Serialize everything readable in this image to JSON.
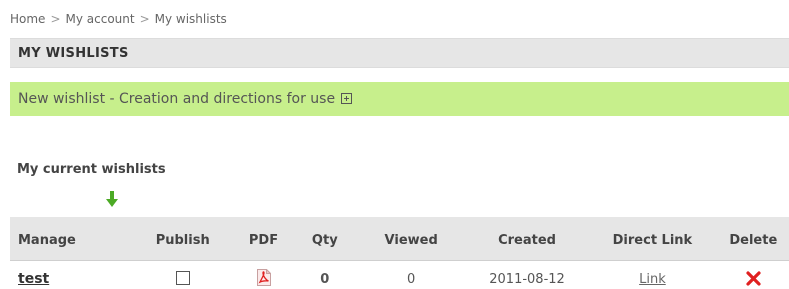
{
  "breadcrumb": {
    "items": [
      "Home",
      "My account",
      "My wishlists"
    ],
    "separator": ">"
  },
  "page_title": "MY WISHLISTS",
  "create_bar": {
    "label": "New wishlist - Creation and directions for use",
    "icon": "expand-plus-icon"
  },
  "wishlists": {
    "heading": "My current wishlists",
    "arrow_icon": "green-down-arrow-icon",
    "columns": [
      "Manage",
      "Publish",
      "PDF",
      "Qty",
      "Viewed",
      "Created",
      "Direct Link",
      "Delete"
    ],
    "rows": [
      {
        "name": "test",
        "published": false,
        "pdf_icon": "pdf-icon",
        "qty": "0",
        "viewed": "0",
        "created": "2011-08-12",
        "direct_link": "Link",
        "delete_icon": "red-x-icon"
      }
    ]
  },
  "colors": {
    "create_bar_bg": "#c7ef8c",
    "header_bg": "#e6e6e6",
    "delete_red": "#e02020",
    "arrow_green": "#4caa25"
  }
}
